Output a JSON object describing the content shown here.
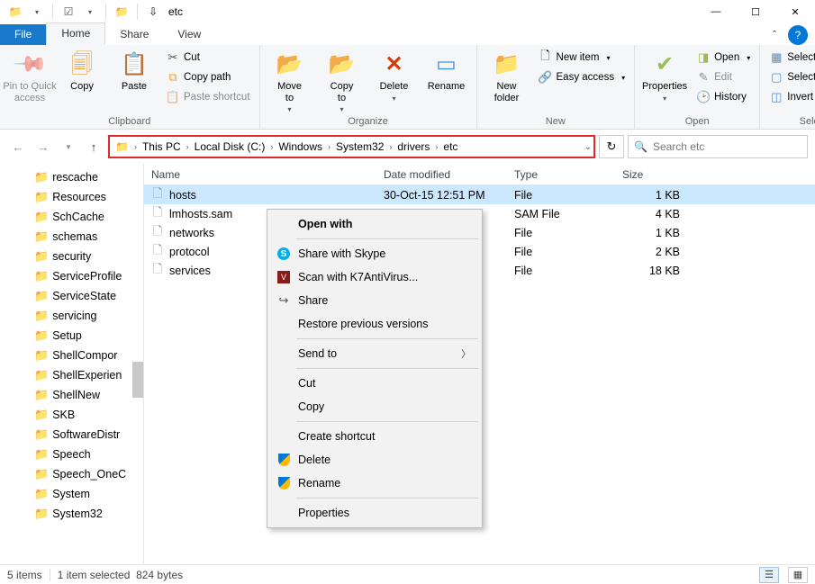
{
  "window": {
    "title": "etc"
  },
  "tabs": {
    "file": "File",
    "home": "Home",
    "share": "Share",
    "view": "View"
  },
  "ribbon": {
    "clipboard": {
      "label": "Clipboard",
      "pin": "Pin to Quick\naccess",
      "copy": "Copy",
      "paste": "Paste",
      "cut": "Cut",
      "copypath": "Copy path",
      "pastesc": "Paste shortcut"
    },
    "organize": {
      "label": "Organize",
      "moveto": "Move\nto",
      "copyto": "Copy\nto",
      "delete": "Delete",
      "rename": "Rename"
    },
    "new": {
      "label": "New",
      "newfolder": "New\nfolder",
      "newitem": "New item",
      "easyaccess": "Easy access"
    },
    "open": {
      "label": "Open",
      "properties": "Properties",
      "open": "Open",
      "edit": "Edit",
      "history": "History"
    },
    "select": {
      "label": "Select",
      "all": "Select all",
      "none": "Select none",
      "invert": "Invert selection"
    }
  },
  "address": {
    "segments": [
      "This PC",
      "Local Disk (C:)",
      "Windows",
      "System32",
      "drivers",
      "etc"
    ]
  },
  "search": {
    "placeholder": "Search etc"
  },
  "columns": {
    "name": "Name",
    "date": "Date modified",
    "type": "Type",
    "size": "Size"
  },
  "tree": [
    "rescache",
    "Resources",
    "SchCache",
    "schemas",
    "security",
    "ServiceProfile",
    "ServiceState",
    "servicing",
    "Setup",
    "ShellCompor",
    "ShellExperien",
    "ShellNew",
    "SKB",
    "SoftwareDistr",
    "Speech",
    "Speech_OneC",
    "System",
    "System32"
  ],
  "files": [
    {
      "name": "hosts",
      "date": "30-Oct-15 12:51 PM",
      "type": "File",
      "size": "1 KB",
      "selected": true
    },
    {
      "name": "lmhosts.sam",
      "date": "",
      "type": "SAM File",
      "size": "4 KB",
      "selected": false
    },
    {
      "name": "networks",
      "date": "",
      "type": "File",
      "size": "1 KB",
      "selected": false
    },
    {
      "name": "protocol",
      "date": "",
      "type": "File",
      "size": "2 KB",
      "selected": false
    },
    {
      "name": "services",
      "date": "",
      "type": "File",
      "size": "18 KB",
      "selected": false
    }
  ],
  "context": {
    "openwith": "Open with",
    "skype": "Share with Skype",
    "k7": "Scan with K7AntiVirus...",
    "share": "Share",
    "restore": "Restore previous versions",
    "sendto": "Send to",
    "cut": "Cut",
    "copy": "Copy",
    "shortcut": "Create shortcut",
    "delete": "Delete",
    "rename": "Rename",
    "properties": "Properties"
  },
  "status": {
    "items": "5 items",
    "selected": "1 item selected",
    "bytes": "824 bytes"
  }
}
